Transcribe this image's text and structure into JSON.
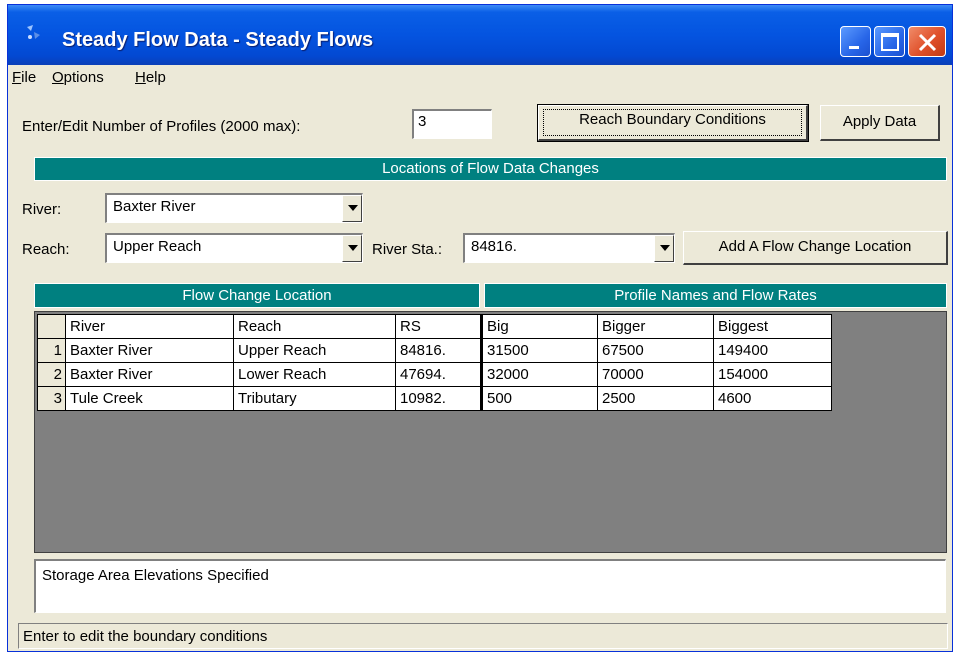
{
  "window": {
    "title": "Steady Flow Data - Steady Flows"
  },
  "menu": {
    "file": {
      "underline": "F",
      "rest": "ile"
    },
    "options": {
      "underline": "O",
      "rest": "ptions"
    },
    "help": {
      "underline": "H",
      "rest": "elp"
    }
  },
  "profiles": {
    "label": "Enter/Edit Number of Profiles (2000 max):",
    "value": "3"
  },
  "buttons": {
    "reach_boundary": "Reach Boundary Conditions",
    "apply_data": "Apply Data",
    "add_flow_change": "Add A Flow Change Location"
  },
  "locations": {
    "header": "Locations of Flow Data Changes",
    "river_label": "River:",
    "river_value": "Baxter River",
    "reach_label": "Reach:",
    "reach_value": "Upper Reach",
    "station_label": "River Sta.:",
    "station_value": "84816."
  },
  "table": {
    "left_header": "Flow Change Location",
    "right_header": "Profile Names and Flow Rates",
    "columns": [
      "River",
      "Reach",
      "RS",
      "Big",
      "Bigger",
      "Biggest"
    ],
    "rows": [
      {
        "num": "1",
        "river": "Baxter River",
        "reach": "Upper Reach",
        "rs": "84816.",
        "big": "31500",
        "bigger": "67500",
        "biggest": "149400"
      },
      {
        "num": "2",
        "river": "Baxter River",
        "reach": "Lower Reach",
        "rs": "47694.",
        "big": "32000",
        "bigger": "70000",
        "biggest": "154000"
      },
      {
        "num": "3",
        "river": "Tule Creek",
        "reach": "Tributary",
        "rs": "10982.",
        "big": "500",
        "bigger": "2500",
        "biggest": "4600"
      }
    ]
  },
  "storage": {
    "text": "Storage Area Elevations Specified"
  },
  "status": {
    "text": "Enter to edit the boundary conditions"
  },
  "colors": {
    "title_bar": "#0454e0",
    "section_header": "#008080",
    "window_bg": "#ece9d8",
    "grid_bg": "#808080"
  }
}
